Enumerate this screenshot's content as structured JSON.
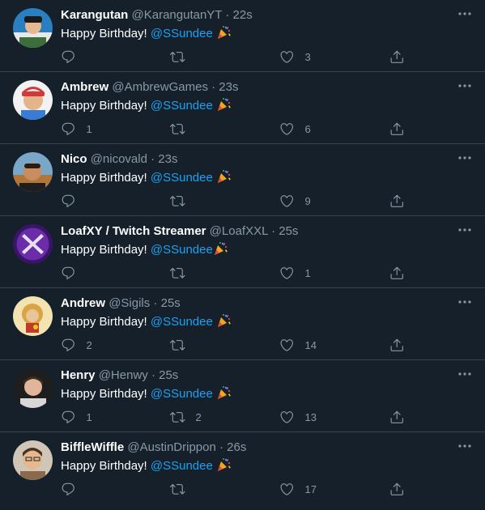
{
  "colors": {
    "background": "#15202b",
    "divider": "#38444d",
    "secondary_text": "#8899a6",
    "mention": "#1da1f2"
  },
  "icons": {
    "reply": "reply-icon",
    "retweet": "retweet-icon",
    "like": "like-icon",
    "share": "share-icon",
    "more": "more-icon",
    "emoji": "party-popper-icon"
  },
  "tweets": [
    {
      "name": "Karangutan",
      "handle": "@KarangutanYT",
      "dot": "·",
      "time": "22s",
      "text": "Happy Birthday! ",
      "mention": "@SSundee",
      "replies": "",
      "retweets": "",
      "likes": "3",
      "avatar_bg": "#2a7fc0"
    },
    {
      "name": "Ambrew",
      "handle": "@AmbrewGames",
      "dot": "·",
      "time": "23s",
      "text": "Happy Birthday! ",
      "mention": "@SSundee",
      "replies": "1",
      "retweets": "",
      "likes": "6",
      "avatar_bg": "#d23a3a"
    },
    {
      "name": "Nico",
      "handle": "@nicovald",
      "dot": "·",
      "time": "23s",
      "text": "Happy Birthday! ",
      "mention": "@SSundee",
      "replies": "",
      "retweets": "",
      "likes": "9",
      "avatar_bg": "#c07a3a"
    },
    {
      "name": "LoafXY / Twitch Streamer",
      "handle": "@LoafXXL",
      "dot": "·",
      "time": "25s",
      "text": "Happy Birthday! ",
      "mention": "@SSundee",
      "replies": "",
      "retweets": "",
      "likes": "1",
      "avatar_bg": "#6a2ca8"
    },
    {
      "name": "Andrew",
      "handle": "@Sigils",
      "dot": "·",
      "time": "25s",
      "text": "Happy Birthday! ",
      "mention": "@SSundee",
      "replies": "2",
      "retweets": "",
      "likes": "14",
      "avatar_bg": "#d9a441"
    },
    {
      "name": "Henry",
      "handle": "@Henwy",
      "dot": "·",
      "time": "25s",
      "text": "Happy Birthday! ",
      "mention": "@SSundee",
      "replies": "1",
      "retweets": "2",
      "likes": "13",
      "avatar_bg": "#2b2b2b"
    },
    {
      "name": "BiffleWiffle",
      "handle": "@AustinDrippon",
      "dot": "·",
      "time": "26s",
      "text": "Happy Birthday! ",
      "mention": "@SSundee",
      "replies": "",
      "retweets": "",
      "likes": "17",
      "avatar_bg": "#c9a27a"
    }
  ]
}
